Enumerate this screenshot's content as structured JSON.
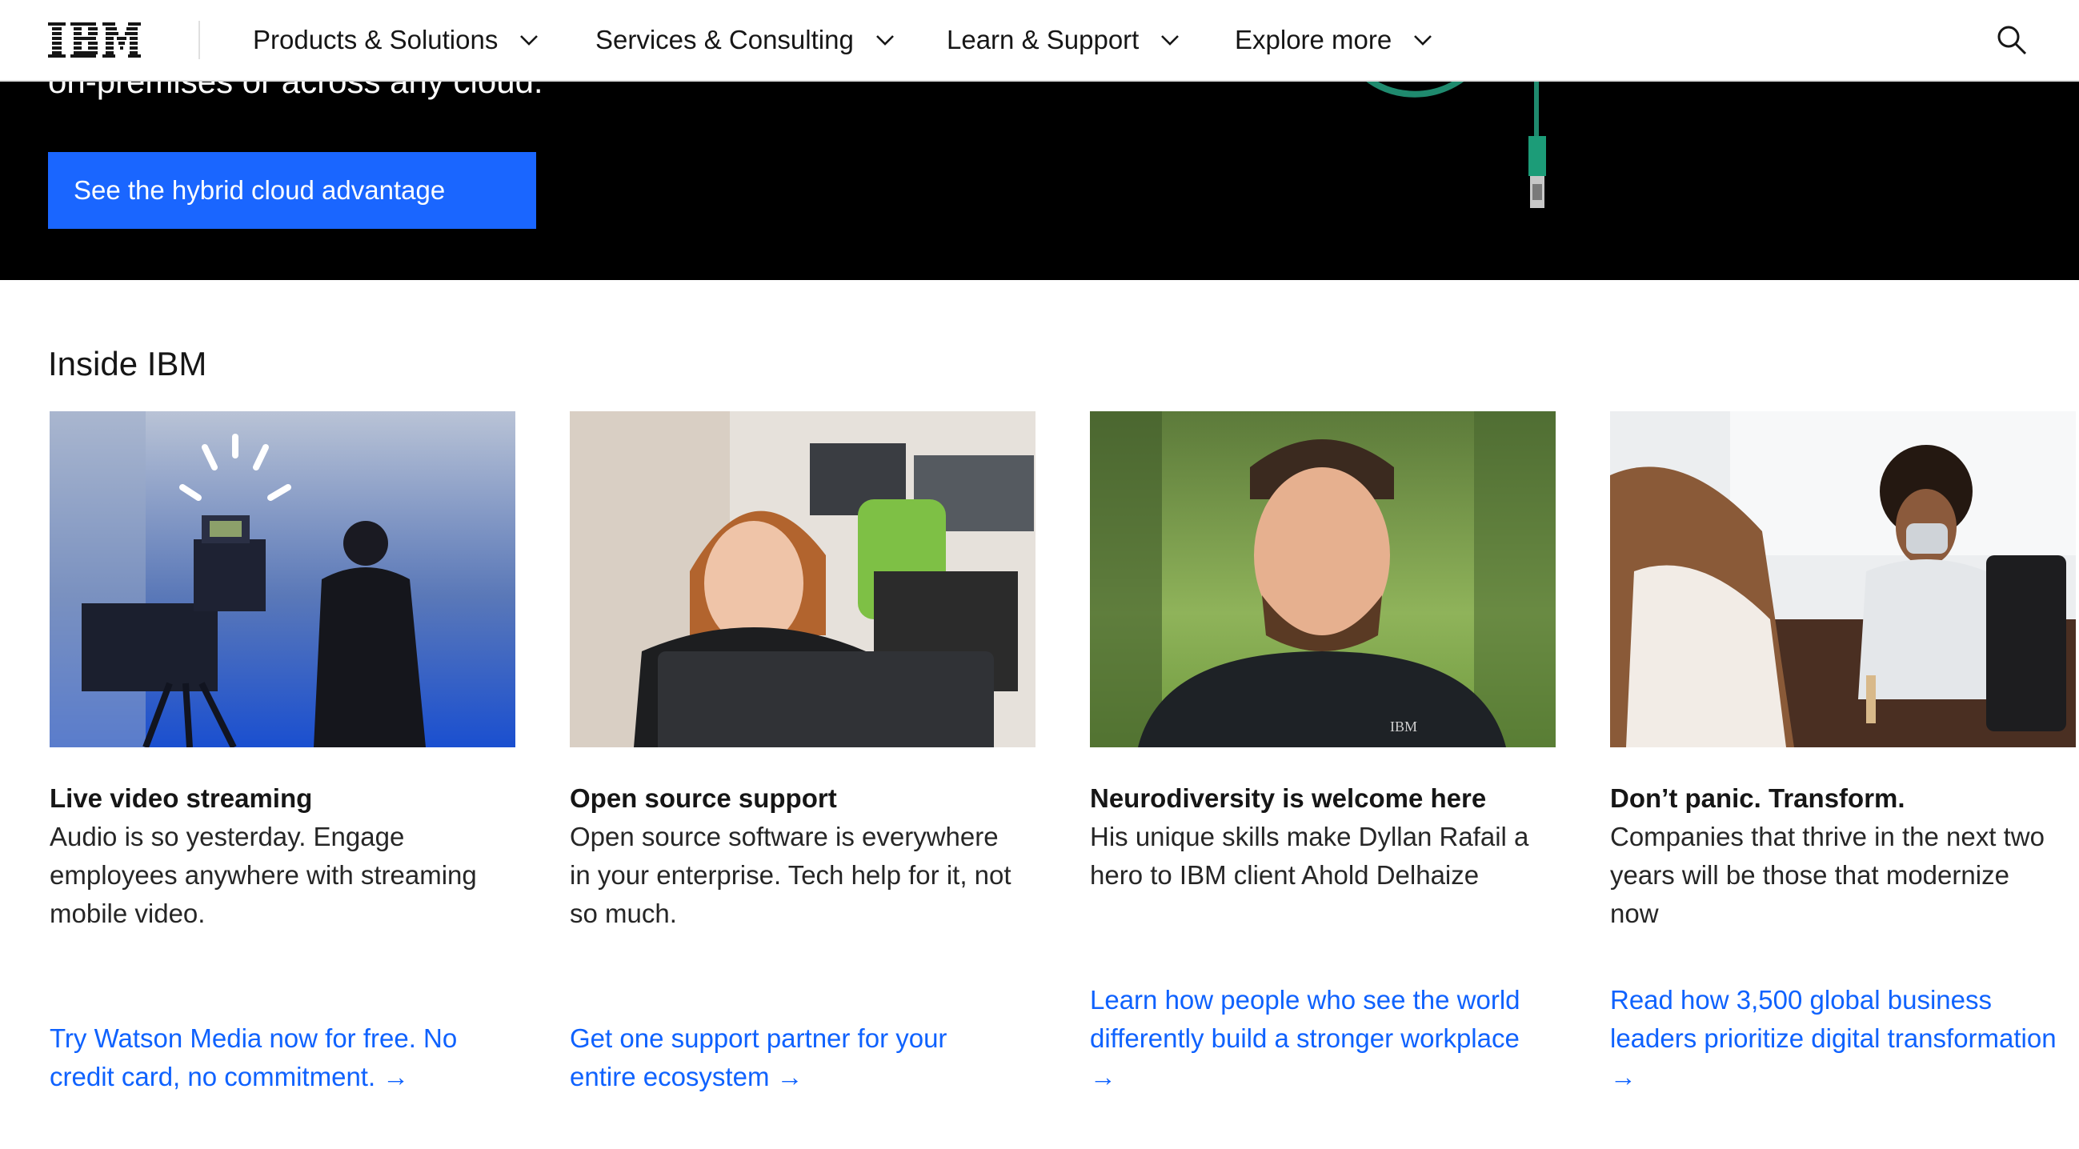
{
  "nav": {
    "logo_text": "IBM",
    "items": [
      {
        "label": "Products & Solutions"
      },
      {
        "label": "Services & Consulting"
      },
      {
        "label": "Learn & Support"
      },
      {
        "label": "Explore more"
      }
    ],
    "search_icon": "search-icon"
  },
  "hero": {
    "text": "on-premises or across any cloud.",
    "cta_label": "See the hybrid cloud advantage",
    "accent_color": "#1a66ff"
  },
  "section": {
    "title": "Inside IBM",
    "cards": [
      {
        "title": "Live video streaming",
        "description": "Audio is so yesterday. Engage employees anywhere with streaming mobile video.",
        "link": "Try Watson Media now for free. No credit card, no commitment. →"
      },
      {
        "title": "Open source support",
        "description": "Open source software is everywhere in your enterprise. Tech help for it, not so much.",
        "link": "Get one support partner for your entire ecosystem →"
      },
      {
        "title": "Neurodiversity is welcome here",
        "description": "His unique skills make Dyllan Rafail a hero to IBM client Ahold Delhaize",
        "link": "Learn how people who see the world differently build a stronger workplace →"
      },
      {
        "title": "Don’t panic. Transform.",
        "description": "Companies that thrive in the next two years will be those that modernize now",
        "link": "Read how 3,500 global business leaders prioritize digital transformation →"
      }
    ],
    "link_color": "#0f62fe"
  }
}
